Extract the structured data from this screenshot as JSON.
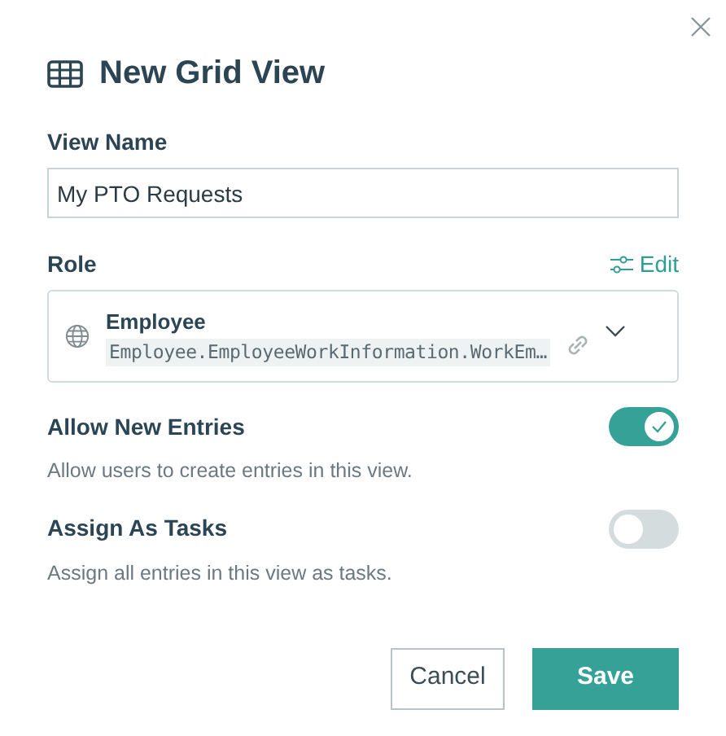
{
  "dialog": {
    "title": "New Grid View"
  },
  "view_name": {
    "label": "View Name",
    "value": "My PTO Requests"
  },
  "role": {
    "label": "Role",
    "edit_label": "Edit",
    "name": "Employee",
    "path": "Employee.EmployeeWorkInformation.WorkEm…"
  },
  "options": [
    {
      "label": "Allow New Entries",
      "description": "Allow users to create entries in this view.",
      "on": true
    },
    {
      "label": "Assign As Tasks",
      "description": "Assign all entries in this view as tasks.",
      "on": false
    }
  ],
  "buttons": [
    {
      "label": "Cancel",
      "kind": "secondary"
    },
    {
      "label": "Save",
      "kind": "primary"
    }
  ]
}
